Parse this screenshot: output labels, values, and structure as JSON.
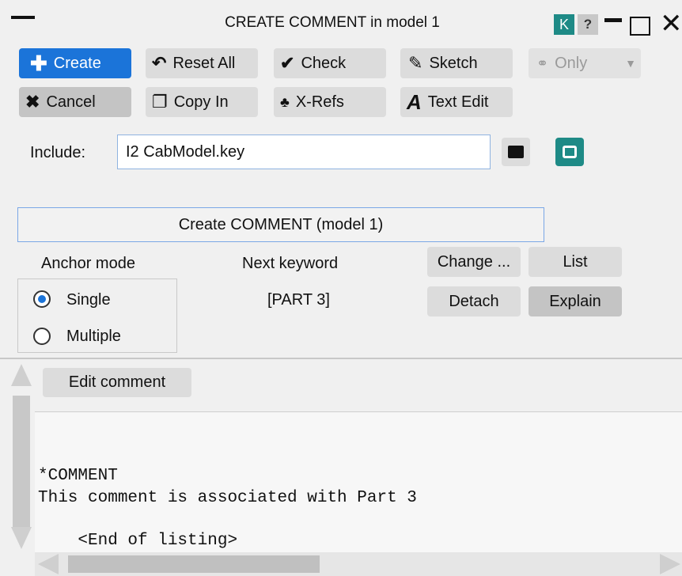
{
  "window": {
    "title": "CREATE COMMENT in model 1",
    "k_label": "K",
    "help_label": "?"
  },
  "toolbar": {
    "create": "Create",
    "reset_all": "Reset All",
    "check": "Check",
    "sketch": "Sketch",
    "only": "Only",
    "cancel": "Cancel",
    "copy_in": "Copy In",
    "x_refs": "X-Refs",
    "text_edit": "Text Edit"
  },
  "include": {
    "label": "Include:",
    "value": "I2  CabModel.key"
  },
  "create_banner": "Create COMMENT (model 1)",
  "anchor": {
    "title": "Anchor mode",
    "options": [
      "Single",
      "Multiple"
    ],
    "selected": "Single"
  },
  "next_keyword": {
    "title": "Next keyword",
    "value": "[PART 3]"
  },
  "actions": {
    "change": "Change ...",
    "list": "List",
    "detach": "Detach",
    "explain": "Explain"
  },
  "editor": {
    "edit_button": "Edit comment",
    "lines": [
      "*COMMENT",
      "This comment is associated with Part 3",
      "    <End of listing>"
    ]
  },
  "icons": {
    "create": "plus-icon",
    "reset": "undo-icon",
    "check": "checkmark-icon",
    "sketch": "pencil-icon",
    "only": "binoculars-icon",
    "cancel": "x-icon",
    "copy_in": "copy-icon",
    "x_refs": "hierarchy-icon",
    "text_edit": "letter-a-icon",
    "folder": "folder-icon",
    "clipboard": "clipboard-icon"
  },
  "colors": {
    "accent_blue": "#1b74d9",
    "teal": "#1e8a86"
  }
}
